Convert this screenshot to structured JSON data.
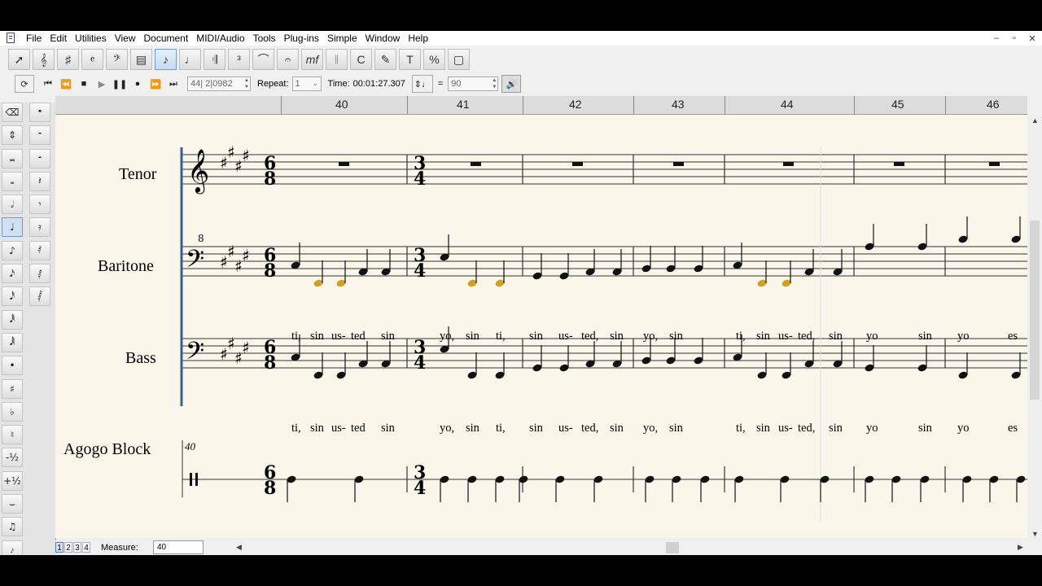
{
  "menu": [
    "File",
    "Edit",
    "Utilities",
    "View",
    "Document",
    "MIDI/Audio",
    "Tools",
    "Plug-ins",
    "Simple",
    "Window",
    "Help"
  ],
  "window_controls": [
    "–",
    "▫",
    "✕"
  ],
  "toolbar_icons": [
    "arrow-tool-icon",
    "clef-tool-icon",
    "key-tool-icon",
    "time-tool-icon",
    "bass-clef-tool-icon",
    "measure-tool-icon",
    "simple-entry-icon",
    "speedy-entry-icon",
    "repeat-tool-icon",
    "tuplet-tool-icon",
    "smart-shape-icon",
    "articulation-icon",
    "expression-icon",
    "staff-tool-icon",
    "chord-tool-icon",
    "lyrics-tool-icon",
    "text-tool-icon",
    "resize-tool-icon",
    "selection-tool-icon"
  ],
  "playback": {
    "position": "44| 2|0982",
    "repeat_label": "Repeat:",
    "repeat_value": "1",
    "time_label": "Time:",
    "time_value": "00:01:27.307",
    "tempo_eq": "=",
    "tempo_value": "90"
  },
  "ruler": [
    "40",
    "41",
    "42",
    "43",
    "44",
    "45",
    "46"
  ],
  "instruments": [
    "Tenor",
    "Baritone",
    "Bass",
    "Agogo Block"
  ],
  "time_signatures": [
    {
      "upper": "6",
      "lower": "8"
    },
    {
      "upper": "3",
      "lower": "4"
    }
  ],
  "tenor_clef_octave": "8",
  "measure_number": "40",
  "lyrics": {
    "baritone": [
      "ti,",
      "sin",
      "us-",
      "ted",
      "sin",
      "yo,",
      "sin",
      "ti,",
      "sin",
      "us-",
      "ted,",
      "sin",
      "yo,",
      "sin",
      "ti,",
      "sin",
      "us-",
      "ted,",
      "sin",
      "yo",
      "sin",
      "yo",
      "es"
    ],
    "bass": [
      "ti,",
      "sin",
      "us-",
      "ted",
      "sin",
      "yo,",
      "sin",
      "ti,",
      "sin",
      "us-",
      "ted,",
      "sin",
      "yo,",
      "sin",
      "ti,",
      "sin",
      "us-",
      "ted,",
      "sin",
      "yo",
      "sin",
      "yo",
      "es"
    ]
  },
  "bottom": {
    "pages": [
      "1",
      "2",
      "3",
      "4"
    ],
    "measure_label": "Measure:",
    "measure_value": "40"
  },
  "colors": {
    "highlight_note": "#d4a017",
    "selection_bar": "#3a5a9a",
    "paper": "#faf7ea"
  }
}
